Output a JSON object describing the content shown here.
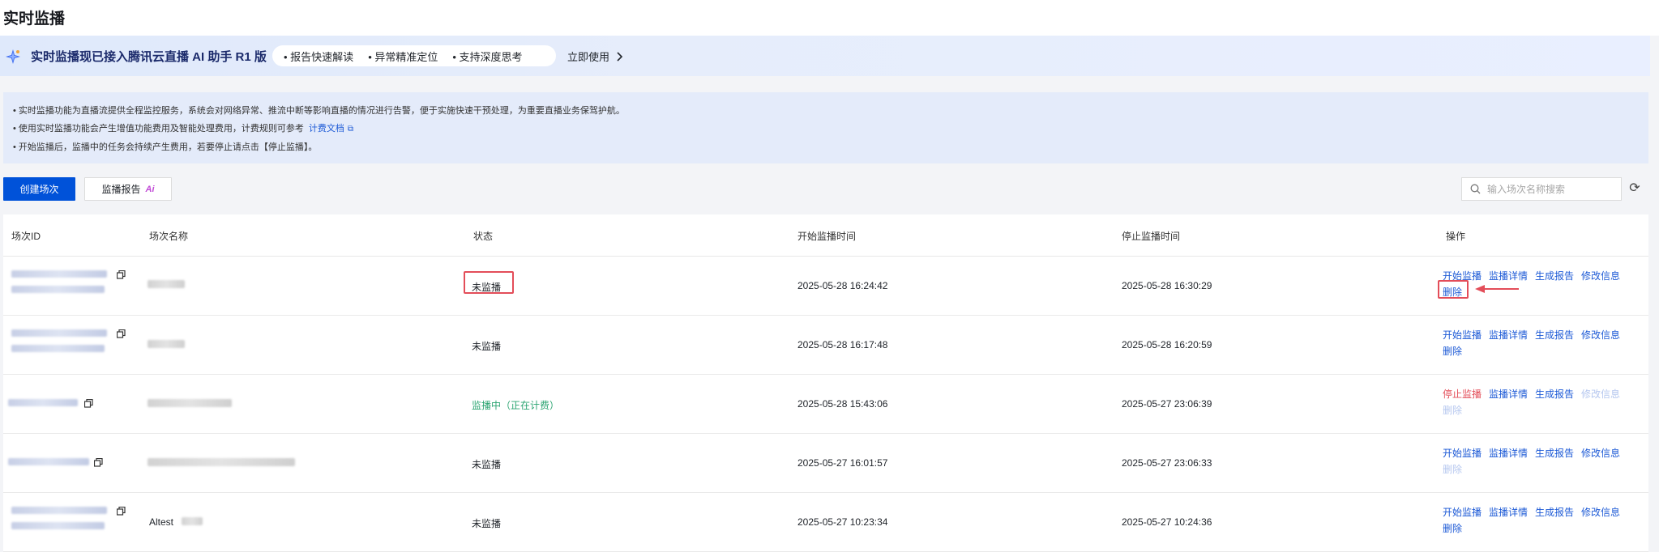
{
  "page": {
    "title": "实时监播"
  },
  "ai_banner": {
    "title": "实时监播现已接入腾讯云直播 AI 助手 R1 版",
    "features": [
      "报告快速解读",
      "异常精准定位",
      "支持深度思考"
    ],
    "cta": "立即使用"
  },
  "info": {
    "line1": "实时监播功能为直播流提供全程监控服务，系统会对网络异常、推流中断等影响直播的情况进行告警，便于实施快速干预处理，为重要直播业务保驾护航。",
    "line2": "使用实时监播功能会产生增值功能费用及智能处理费用，计费规则可参考",
    "line2_link": "计费文档",
    "line3": "开始监播后，监播中的任务会持续产生费用，若要停止请点击【停止监播】。"
  },
  "toolbar": {
    "create_label": "创建场次",
    "report_label": "监播报告",
    "report_ai_tag": "Ai",
    "search_placeholder": "输入场次名称搜索"
  },
  "table": {
    "columns": [
      "场次ID",
      "场次名称",
      "状态",
      "开始监播时间",
      "停止监播时间",
      "操作"
    ],
    "rows": [
      {
        "name": "",
        "status": "未监播",
        "start": "2025-05-28 16:24:42",
        "stop": "2025-05-28 16:30:29",
        "ops": [
          "开始监播",
          "监播详情",
          "生成报告",
          "修改信息",
          "删除"
        ]
      },
      {
        "name": "",
        "status": "未监播",
        "start": "2025-05-28 16:17:48",
        "stop": "2025-05-28 16:20:59",
        "ops": [
          "开始监播",
          "监播详情",
          "生成报告",
          "修改信息",
          "删除"
        ]
      },
      {
        "name": "",
        "status": "监播中（正在计费）",
        "start": "2025-05-28 15:43:06",
        "stop": "2025-05-27 23:06:39",
        "ops": [
          "停止监播",
          "监播详情",
          "生成报告",
          "修改信息",
          "删除"
        ]
      },
      {
        "name": "",
        "status": "未监播",
        "start": "2025-05-27 16:01:57",
        "stop": "2025-05-27 23:06:33",
        "ops": [
          "开始监播",
          "监播详情",
          "生成报告",
          "修改信息",
          "删除"
        ]
      },
      {
        "name": "Altest",
        "status": "未监播",
        "start": "2025-05-27 10:23:34",
        "stop": "2025-05-27 10:24:36",
        "ops": [
          "开始监播",
          "监播详情",
          "生成报告",
          "修改信息",
          "删除"
        ]
      }
    ]
  },
  "colors": {
    "primary": "#0052d9",
    "link": "#1d5ad6",
    "danger": "#e34d59",
    "success": "#2ba471",
    "highlight": "#e34d59"
  }
}
